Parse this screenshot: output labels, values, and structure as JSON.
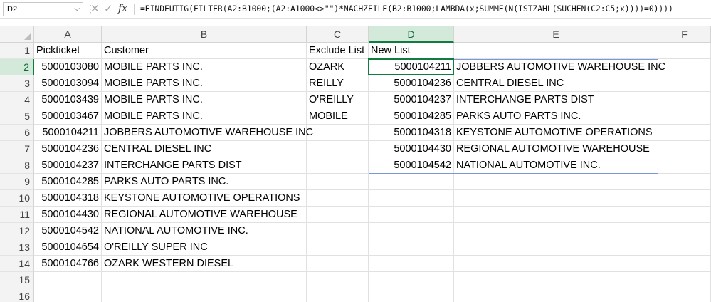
{
  "formula_bar": {
    "name_box": "D2",
    "formula": "=EINDEUTIG(FILTER(A2:B1000;(A2:A1000<>\"\")*NACHZEILE(B2:B1000;LAMBDA(x;SUMME(N(ISTZAHL(SUCHEN(C2:C5;x))))=0))))"
  },
  "columns": [
    "A",
    "B",
    "C",
    "D",
    "E",
    "F"
  ],
  "active_column": "D",
  "active_row": 2,
  "rows": [
    {
      "n": "1",
      "a": "Pickticket",
      "b": "Customer",
      "c": "Exclude List",
      "d": "New List",
      "e": ""
    },
    {
      "n": "2",
      "a": "5000103080",
      "b": "MOBILE PARTS INC.",
      "c": "OZARK",
      "d": "5000104211",
      "e": "JOBBERS AUTOMOTIVE WAREHOUSE INC"
    },
    {
      "n": "3",
      "a": "5000103094",
      "b": "MOBILE PARTS INC.",
      "c": "REILLY",
      "d": "5000104236",
      "e": "CENTRAL DIESEL INC"
    },
    {
      "n": "4",
      "a": "5000103439",
      "b": "MOBILE PARTS INC.",
      "c": "O'REILLY",
      "d": "5000104237",
      "e": "INTERCHANGE PARTS DIST"
    },
    {
      "n": "5",
      "a": "5000103467",
      "b": "MOBILE PARTS INC.",
      "c": "MOBILE",
      "d": "5000104285",
      "e": "PARKS AUTO PARTS INC."
    },
    {
      "n": "6",
      "a": "5000104211",
      "b": "JOBBERS AUTOMOTIVE WAREHOUSE INC",
      "c": "",
      "d": "5000104318",
      "e": "KEYSTONE AUTOMOTIVE OPERATIONS"
    },
    {
      "n": "7",
      "a": "5000104236",
      "b": "CENTRAL DIESEL INC",
      "c": "",
      "d": "5000104430",
      "e": "REGIONAL AUTOMOTIVE WAREHOUSE"
    },
    {
      "n": "8",
      "a": "5000104237",
      "b": "INTERCHANGE PARTS DIST",
      "c": "",
      "d": "5000104542",
      "e": "NATIONAL AUTOMOTIVE INC."
    },
    {
      "n": "9",
      "a": "5000104285",
      "b": "PARKS AUTO PARTS INC.",
      "c": "",
      "d": "",
      "e": ""
    },
    {
      "n": "10",
      "a": "5000104318",
      "b": "KEYSTONE AUTOMOTIVE OPERATIONS",
      "c": "",
      "d": "",
      "e": ""
    },
    {
      "n": "11",
      "a": "5000104430",
      "b": "REGIONAL AUTOMOTIVE WAREHOUSE",
      "c": "",
      "d": "",
      "e": ""
    },
    {
      "n": "12",
      "a": "5000104542",
      "b": "NATIONAL AUTOMOTIVE INC.",
      "c": "",
      "d": "",
      "e": ""
    },
    {
      "n": "13",
      "a": "5000104654",
      "b": "O'REILLY SUPER INC",
      "c": "",
      "d": "",
      "e": ""
    },
    {
      "n": "14",
      "a": "5000104766",
      "b": "OZARK WESTERN DIESEL",
      "c": "",
      "d": "",
      "e": ""
    },
    {
      "n": "15",
      "a": "",
      "b": "",
      "c": "",
      "d": "",
      "e": ""
    },
    {
      "n": "16",
      "a": "",
      "b": "",
      "c": "",
      "d": "",
      "e": ""
    }
  ],
  "icons": {
    "name_box_dropdown": "chevron-down-icon",
    "cancel": "cross-icon",
    "enter": "check-icon",
    "insert_function": "fx-icon",
    "select_all": "select-all-triangle-icon"
  },
  "colors": {
    "selection": "#107c41",
    "header_active_bg": "#d3eadb",
    "spill_border": "#7b98d6",
    "gridline": "#e1e1e1"
  }
}
